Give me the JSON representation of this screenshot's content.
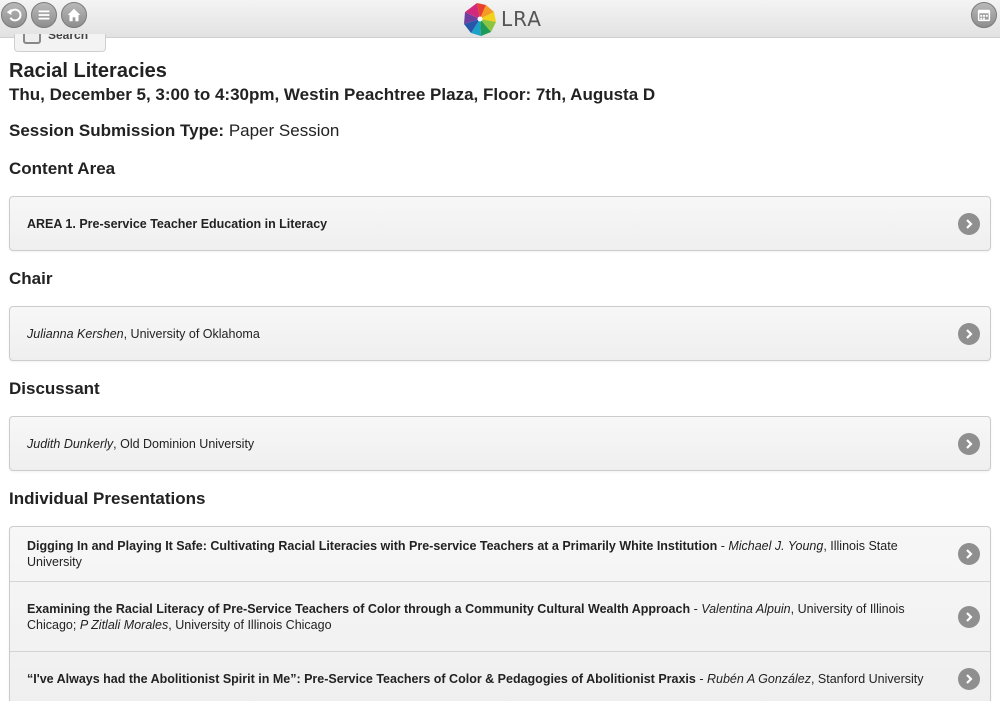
{
  "header": {
    "brand_text": "LRA",
    "search_tab_label": "Search"
  },
  "session": {
    "title": "Racial Literacies",
    "when_where": "Thu, December 5, 3:00 to 4:30pm, Westin Peachtree Plaza, Floor: 7th, Augusta D",
    "submission_type_label": "Session Submission Type:",
    "submission_type_value": "Paper Session"
  },
  "content_area": {
    "heading": "Content Area",
    "item": "AREA 1. Pre-service Teacher Education in Literacy"
  },
  "chair": {
    "heading": "Chair",
    "name": "Julianna Kershen",
    "affiliation": ", University of Oklahoma"
  },
  "discussant": {
    "heading": "Discussant",
    "name": "Judith Dunkerly",
    "affiliation": ", Old Dominion University"
  },
  "presentations": {
    "heading": "Individual Presentations",
    "items": [
      {
        "title": "Digging In and Playing It Safe: Cultivating Racial Literacies with Pre-service Teachers at a Primarily White Institution",
        "sep": " - ",
        "author1": "Michael J. Young",
        "aff1": ", Illinois State University"
      },
      {
        "title": "Examining the Racial Literacy of Pre-Service Teachers of Color through a Community Cultural Wealth Approach",
        "sep": " - ",
        "author1": "Valentina Alpuin",
        "aff1": ", University of Illinois Chicago; ",
        "author2": "P Zitlali Morales",
        "aff2": ", University of Illinois Chicago"
      },
      {
        "title": "“I've Always had the Abolitionist Spirit in Me”: Pre-Service Teachers of Color & Pedagogies of Abolitionist Praxis",
        "sep": " - ",
        "author1": "Rubén A González",
        "aff1": ", Stanford University"
      }
    ]
  },
  "icons": {
    "back": "back-arrow-icon",
    "menu": "menu-icon",
    "home": "home-icon",
    "calendar": "calendar-icon",
    "row_arrow": "chevron-right-icon",
    "logo": "lra-pinwheel-logo"
  },
  "colors": {
    "toolbar_button": "#999999",
    "row_arrow": "#8f8f8f",
    "list_background": "#f3f3f3"
  }
}
